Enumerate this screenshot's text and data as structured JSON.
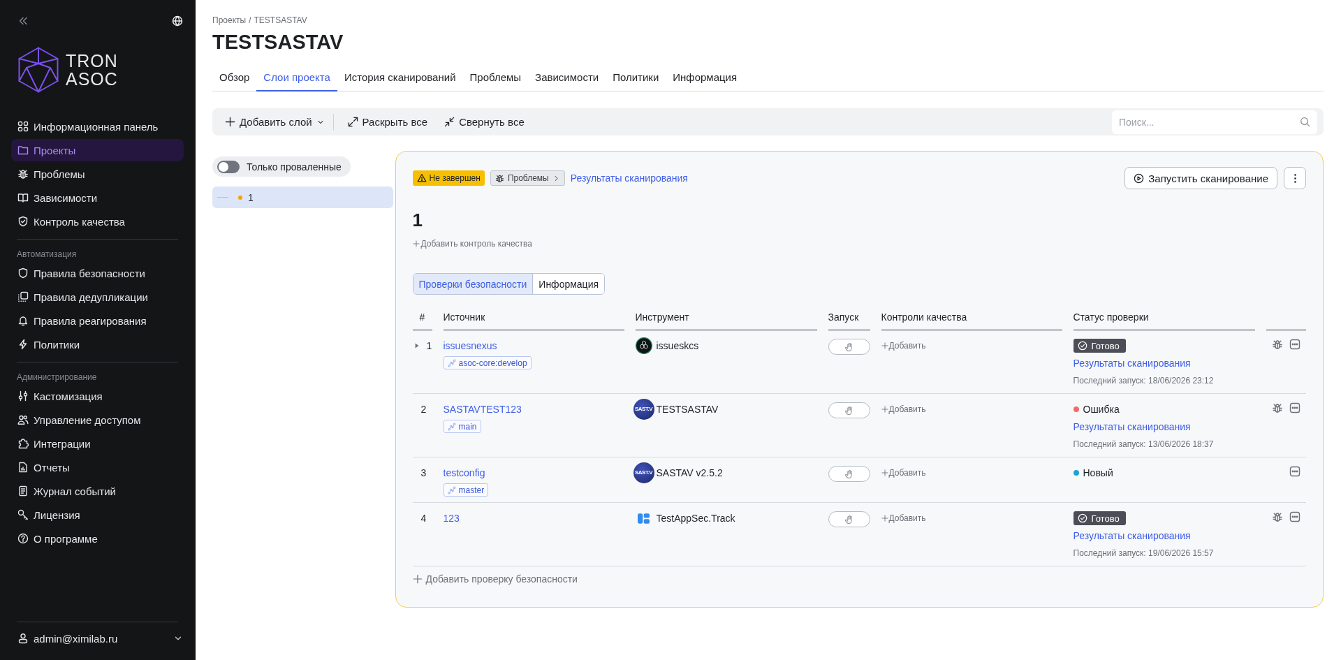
{
  "sidebar": {
    "logo": {
      "line_1": "TRON",
      "line_2": "ASOC"
    },
    "sections": [
      {
        "items": [
          {
            "label": "Информационная панель",
            "selected": false
          },
          {
            "label": "Проекты",
            "selected": true
          },
          {
            "label": "Проблемы",
            "selected": false
          },
          {
            "label": "Зависимости",
            "selected": false
          },
          {
            "label": "Контроль качества",
            "selected": false
          }
        ]
      },
      {
        "heading": "Автоматизация",
        "items": [
          {
            "label": "Правила безопасности",
            "selected": false
          },
          {
            "label": "Правила дедупликации",
            "selected": false
          },
          {
            "label": "Правила реагирования",
            "selected": false
          },
          {
            "label": "Политики",
            "selected": false
          }
        ]
      },
      {
        "heading": "Администрирование",
        "items": [
          {
            "label": "Кастомизация",
            "selected": false
          },
          {
            "label": "Управление доступом",
            "selected": false
          },
          {
            "label": "Интеграции",
            "selected": false
          },
          {
            "label": "Отчеты",
            "selected": false
          },
          {
            "label": "Журнал событий",
            "selected": false
          },
          {
            "label": "Лицензия",
            "selected": false
          },
          {
            "label": "О программе",
            "selected": false
          }
        ]
      }
    ],
    "user": {
      "email": "admin@ximilab.ru"
    }
  },
  "breadcrumb": {
    "items": [
      "Проекты",
      "TESTSASTAV"
    ],
    "separator": "/"
  },
  "title": "TESTSASTAV",
  "tabs": [
    {
      "label": "Обзор",
      "selected": false
    },
    {
      "label": "Слои проекта",
      "selected": true
    },
    {
      "label": "История сканирований",
      "selected": false
    },
    {
      "label": "Проблемы",
      "selected": false
    },
    {
      "label": "Зависимости",
      "selected": false
    },
    {
      "label": "Политики",
      "selected": false
    },
    {
      "label": "Информация",
      "selected": false
    }
  ],
  "toolbar": {
    "buttons": [
      {
        "kind": "menu",
        "label": "Добавить слой"
      },
      {
        "kind": "action",
        "label": "Раскрыть все"
      },
      {
        "kind": "action",
        "label": "Свернуть все"
      }
    ],
    "search": {
      "placeholder": "Поиск..."
    }
  },
  "filter": {
    "label": "Только проваленные",
    "on": false
  },
  "layers": [
    {
      "label": "1",
      "selected": true,
      "color": "#f5a300"
    }
  ],
  "layer": {
    "status": "Не завершен",
    "issues_button": "Проблемы",
    "results_link": "Результаты сканирования",
    "run_button": "Запустить сканирование",
    "name": "1",
    "add_quality_control": "Добавить контроль качества",
    "subtabs": [
      {
        "label": "Проверки безопасности",
        "selected": true
      },
      {
        "label": "Информация",
        "selected": false
      }
    ],
    "table": {
      "columns": [
        "#",
        "Источник",
        "Инструмент",
        "Запуск",
        "Контроли качества",
        "Статус проверки"
      ],
      "rows": [
        {
          "number": "1",
          "expandable": true,
          "source": "issuesnexus",
          "branch": "asoc-core:develop",
          "tool": {
            "kind": "hex",
            "name": "issueskcs"
          },
          "quality_control": "Добавить",
          "status": {
            "kind": "badge",
            "label": "Готово"
          },
          "results_link": "Результаты сканирования",
          "last_run": "Последний запуск: 18/06/2026 23:12",
          "issues_link": true
        },
        {
          "number": "2",
          "expandable": false,
          "source": "SASTAVTEST123",
          "branch": "main",
          "tool": {
            "kind": "text",
            "logo": "SAST.V",
            "name": "TESTSASTAV"
          },
          "quality_control": "Добавить",
          "status": {
            "kind": "dot",
            "label": "Ошибка",
            "color": "#f26b6b"
          },
          "results_link": "Результаты сканирования",
          "last_run": "Последний запуск: 13/06/2026 18:37",
          "issues_link": true
        },
        {
          "number": "3",
          "expandable": false,
          "source": "testconfig",
          "branch": "master",
          "tool": {
            "kind": "text",
            "logo": "SAST.V",
            "name": "SASTAV v2.5.2"
          },
          "quality_control": "Добавить",
          "status": {
            "kind": "dot",
            "label": "Новый",
            "color": "#1ba4d4"
          },
          "issues_link": false
        },
        {
          "number": "4",
          "expandable": false,
          "source": "123",
          "tool": {
            "kind": "blocks",
            "name": "TestAppSec.Track"
          },
          "quality_control": "Добавить",
          "status": {
            "kind": "badge",
            "label": "Готово"
          },
          "results_link": "Результаты сканирования",
          "last_run": "Последний запуск: 19/06/2026 15:57",
          "issues_link": true
        }
      ]
    },
    "add_check": "Добавить проверку безопасности"
  }
}
